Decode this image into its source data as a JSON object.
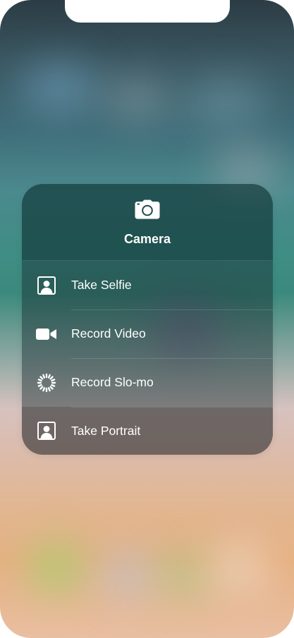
{
  "popup": {
    "title": "Camera",
    "header_icon": "camera-icon",
    "items": [
      {
        "label": "Take Selfie",
        "icon": "selfie-portrait-icon"
      },
      {
        "label": "Record Video",
        "icon": "video-camera-icon"
      },
      {
        "label": "Record Slo-mo",
        "icon": "slo-mo-icon"
      },
      {
        "label": "Take Portrait",
        "icon": "portrait-icon"
      }
    ]
  }
}
